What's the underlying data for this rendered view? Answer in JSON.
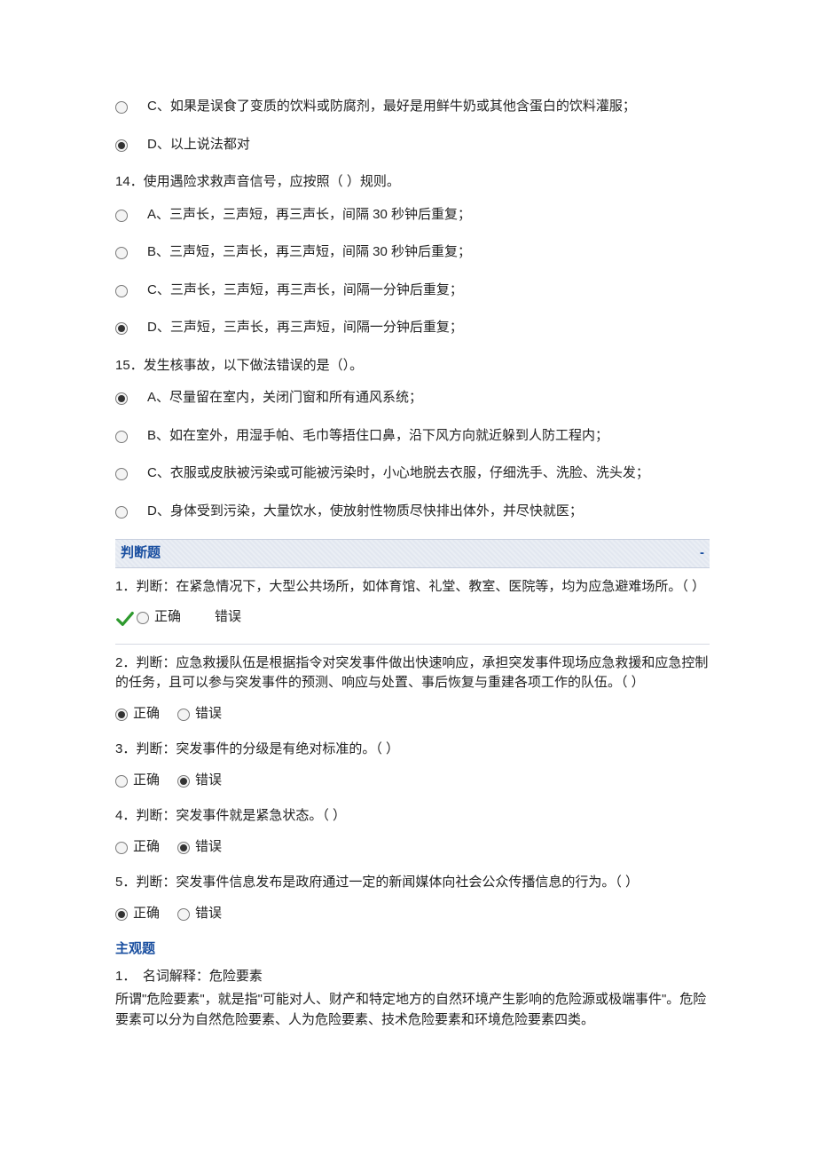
{
  "q13": {
    "options": {
      "c": "C、如果是误食了变质的饮料或防腐剂，最好是用鲜牛奶或其他含蛋白的饮料灌服；",
      "d": "D、以上说法都对"
    }
  },
  "q14": {
    "stem": "14．使用遇险求救声音信号，应按照（ ）规则。",
    "options": {
      "a": "A、三声长，三声短，再三声长，间隔 30 秒钟后重复；",
      "b": "B、三声短，三声长，再三声短，间隔 30 秒钟后重复；",
      "c": "C、三声长，三声短，再三声长，间隔一分钟后重复；",
      "d": "D、三声短，三声长，再三声短，间隔一分钟后重复；"
    }
  },
  "q15": {
    "stem": "15．发生核事故，以下做法错误的是（）。",
    "options": {
      "a": "A、尽量留在室内，关闭门窗和所有通风系统；",
      "b": "B、如在室外，用湿手帕、毛巾等捂住口鼻，沿下风方向就近躲到人防工程内；",
      "c": "C、衣服或皮肤被污染或可能被污染时，小心地脱去衣服，仔细洗手、洗脸、洗头发；",
      "d": "D、身体受到污染，大量饮水，使放射性物质尽快排出体外，并尽快就医；"
    }
  },
  "sections": {
    "judge_title": "判断题",
    "collapse": "-",
    "subjective_title": "主观题"
  },
  "tf": {
    "true": "正确",
    "false": "错误"
  },
  "j1": {
    "stem": "1．判断：在紧急情况下，大型公共场所，如体育馆、礼堂、教室、医院等，均为应急避难场所。（ ）"
  },
  "j2": {
    "stem": "2．判断：应急救援队伍是根据指令对突发事件做出快速响应，承担突发事件现场应急救援和应急控制的任务，且可以参与突发事件的预测、响应与处置、事后恢复与重建各项工作的队伍。（ ）"
  },
  "j3": {
    "stem": "3．判断：突发事件的分级是有绝对标准的。（ ）"
  },
  "j4": {
    "stem": "4．判断：突发事件就是紧急状态。（ ）"
  },
  "j5": {
    "stem": "5．判断：突发事件信息发布是政府通过一定的新闻媒体向社会公众传播信息的行为。（ ）"
  },
  "subj1": {
    "stem": "1．　名词解释：危险要素",
    "body": "所谓\"危险要素\"，就是指\"可能对人、财产和特定地方的自然环境产生影响的危险源或极端事件\"。危险要素可以分为自然危险要素、人为危险要素、技术危险要素和环境危险要素四类。"
  }
}
